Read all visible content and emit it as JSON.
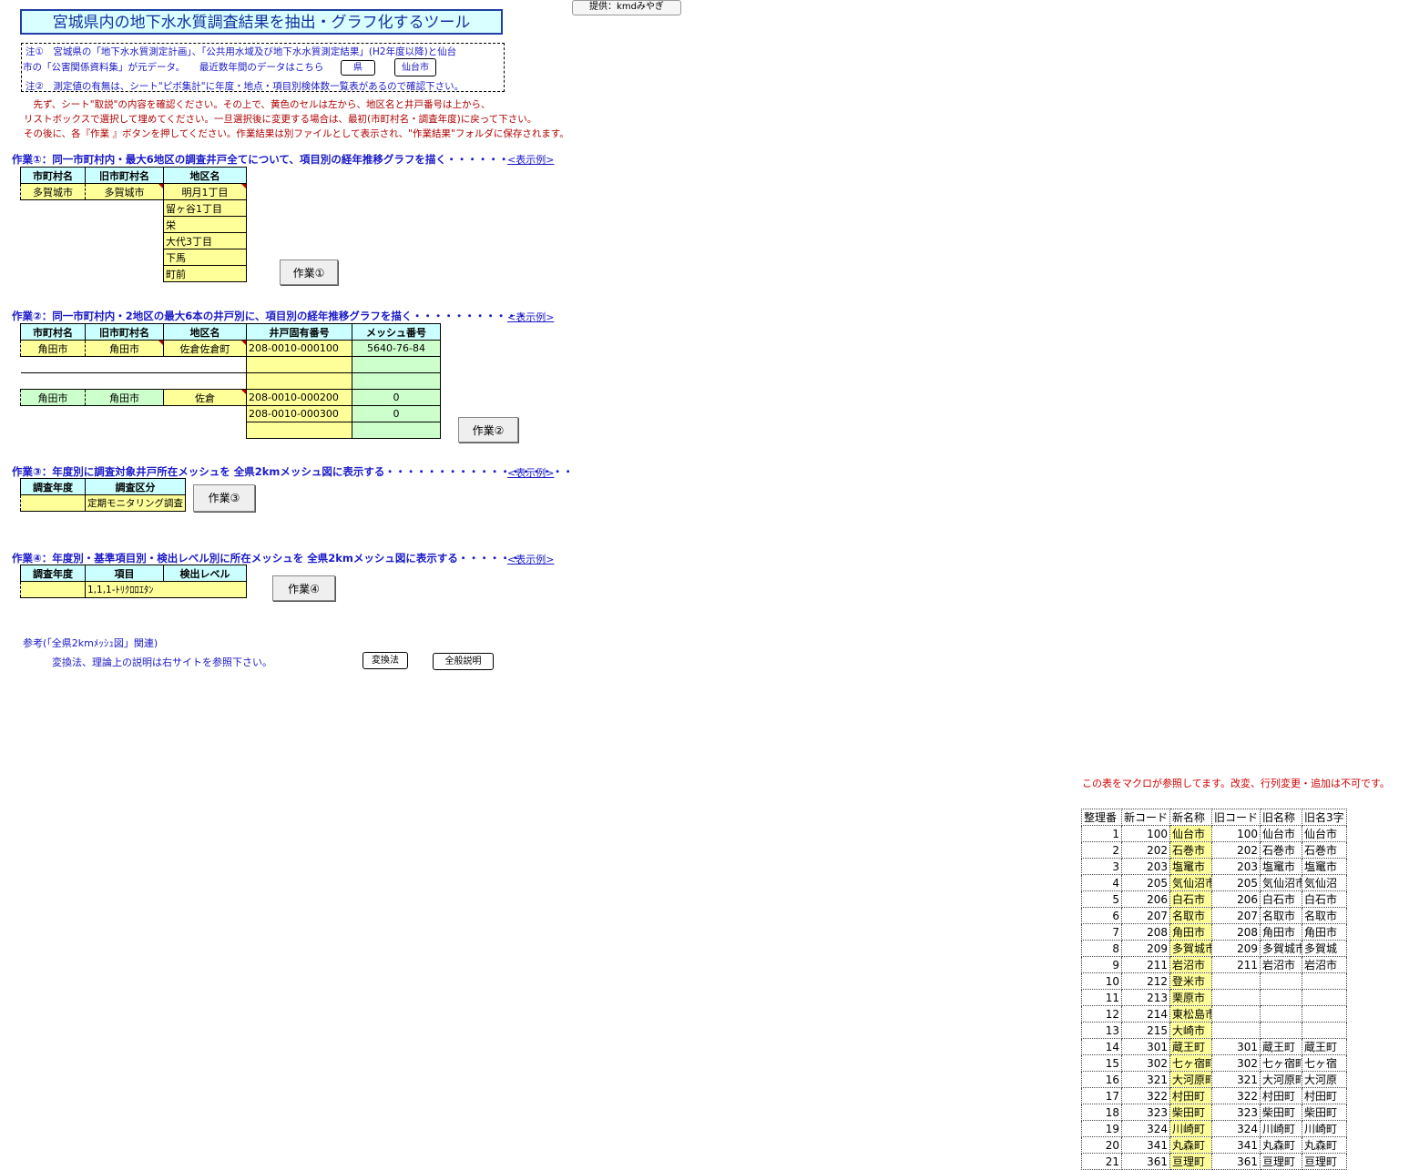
{
  "header": {
    "title": "宮城県内の地下水水質調査結果を抽出・グラフ化するツール",
    "provider": "提供：kmdみやぎ"
  },
  "notes": {
    "note1_line1": "注①　宮城県の「地下水水質測定計画」、「公共用水域及び地下水水質測定結果」(H2年度以降)と仙台",
    "note1_line2": "市の「公害関係資料集」が元データ。　　最近数年間のデータはこちら",
    "btn_pref": "県",
    "btn_sendai": "仙台市",
    "note2": "注②　測定値の有無は、シート\"ピボ集計\"に年度・地点・項目別検体数一覧表があるので確認下さい。"
  },
  "instructions": [
    "　先ず、シート\"取説\"の内容を確認ください。その上で、黄色のセルは左から、地区名と井戸番号は上から、",
    "リストボックスで選択して埋めてください。一旦選択後に変更する場合は、最初(市町村名・調査年度)に戻って下さい。",
    "その後に、各『作業 』ボタンを押してください。作業結果は別ファイルとして表示され、\"作業結果\"フォルダに保存されます。"
  ],
  "task1": {
    "heading": "作業①：同一市町村内・最大6地区の調査井戸全てについて、項目別の経年推移グラフを描く・・・・・・",
    "example_link": "<表示例>",
    "headers": [
      "市町村名",
      "旧市町村名",
      "地区名"
    ],
    "city": "多賀城市",
    "old_city": "多賀城市",
    "districts": [
      "明月1丁目",
      "留ヶ谷1丁目",
      "栄",
      "大代3丁目",
      "下馬",
      "町前"
    ],
    "button": "作業①"
  },
  "task2": {
    "heading": "作業②：同一市町村内・2地区の最大6本の井戸別に、項目別の経年推移グラフを描く・・・・・・・・・・・",
    "example_link": "<表示例>",
    "headers": [
      "市町村名",
      "旧市町村名",
      "地区名",
      "井戸固有番号",
      "メッシュ番号"
    ],
    "group1": {
      "city": "角田市",
      "old_city": "角田市",
      "district": "佐倉佐倉町",
      "wells": [
        "208-0010-000100",
        "",
        ""
      ],
      "meshes": [
        "5640-76-84",
        "",
        ""
      ]
    },
    "group2": {
      "city": "角田市",
      "old_city": "角田市",
      "district": "佐倉",
      "wells": [
        "208-0010-000200",
        "208-0010-000300",
        ""
      ],
      "meshes": [
        "0",
        "0",
        ""
      ]
    },
    "button": "作業②"
  },
  "task3": {
    "heading": "作業③：年度別に調査対象井戸所在メッシュを 全県2kmメッシュ図に表示する・・・・・・・・・・・・・・・・・・",
    "example_link": "<表示例>",
    "headers": [
      "調査年度",
      "調査区分"
    ],
    "year": "",
    "category": "定期モニタリング調査",
    "button": "作業③"
  },
  "task4": {
    "heading": "作業④：年度別・基準項目別・検出レベル別に所在メッシュを 全県2kmメッシュ図に表示する・・・・・・",
    "example_link": "<表示例>",
    "headers": [
      "調査年度",
      "項目",
      "検出レベル"
    ],
    "year": "",
    "item": "1,1,1-ﾄﾘｸﾛﾛｴﾀﾝ",
    "level": "",
    "button": "作業④"
  },
  "reference": {
    "title": "参考(「全県2kmﾒｯｼｭ図」関連)",
    "text": "変換法、理論上の説明は右サイトを参照下さい。",
    "btn_conversion": "変換法",
    "btn_general": "全般説明"
  },
  "macro_table": {
    "warning": "この表をマクロが参照してます。改変、行列変更・追加は不可です。",
    "headers": [
      "整理番",
      "新コード",
      "新名称",
      "旧コード",
      "旧名称",
      "旧名3字"
    ],
    "rows": [
      [
        "1",
        "100",
        "仙台市",
        "100",
        "仙台市",
        "仙台市"
      ],
      [
        "2",
        "202",
        "石巻市",
        "202",
        "石巻市",
        "石巻市"
      ],
      [
        "3",
        "203",
        "塩竃市",
        "203",
        "塩竃市",
        "塩竃市"
      ],
      [
        "4",
        "205",
        "気仙沼市",
        "205",
        "気仙沼市",
        "気仙沼"
      ],
      [
        "5",
        "206",
        "白石市",
        "206",
        "白石市",
        "白石市"
      ],
      [
        "6",
        "207",
        "名取市",
        "207",
        "名取市",
        "名取市"
      ],
      [
        "7",
        "208",
        "角田市",
        "208",
        "角田市",
        "角田市"
      ],
      [
        "8",
        "209",
        "多賀城市",
        "209",
        "多賀城市",
        "多賀城"
      ],
      [
        "9",
        "211",
        "岩沼市",
        "211",
        "岩沼市",
        "岩沼市"
      ],
      [
        "10",
        "212",
        "登米市",
        "",
        "",
        ""
      ],
      [
        "11",
        "213",
        "栗原市",
        "",
        "",
        ""
      ],
      [
        "12",
        "214",
        "東松島市",
        "",
        "",
        ""
      ],
      [
        "13",
        "215",
        "大崎市",
        "",
        "",
        ""
      ],
      [
        "14",
        "301",
        "蔵王町",
        "301",
        "蔵王町",
        "蔵王町"
      ],
      [
        "15",
        "302",
        "七ヶ宿町",
        "302",
        "七ヶ宿町",
        "七ヶ宿"
      ],
      [
        "16",
        "321",
        "大河原町",
        "321",
        "大河原町",
        "大河原"
      ],
      [
        "17",
        "322",
        "村田町",
        "322",
        "村田町",
        "村田町"
      ],
      [
        "18",
        "323",
        "柴田町",
        "323",
        "柴田町",
        "柴田町"
      ],
      [
        "19",
        "324",
        "川崎町",
        "324",
        "川崎町",
        "川崎町"
      ],
      [
        "20",
        "341",
        "丸森町",
        "341",
        "丸森町",
        "丸森町"
      ],
      [
        "21",
        "361",
        "亘理町",
        "361",
        "亘理町",
        "亘理町"
      ]
    ]
  }
}
